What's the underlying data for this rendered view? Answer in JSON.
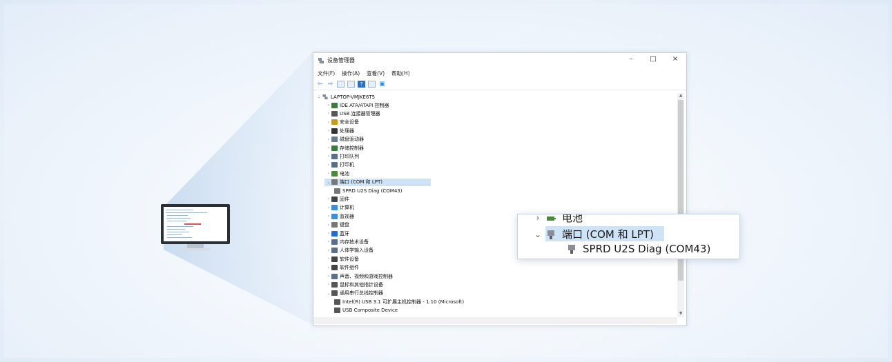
{
  "window": {
    "title": "设备管理器",
    "controls": {
      "minimize": "–",
      "maximize": "□",
      "close": "×"
    }
  },
  "menu": [
    "文件(F)",
    "操作(A)",
    "查看(V)",
    "帮助(H)"
  ],
  "toolbar_icons": [
    "back-arrow-icon",
    "forward-arrow-icon",
    "properties-icon",
    "list-icon",
    "help-icon",
    "view-icon",
    "monitor-icon"
  ],
  "tree": {
    "root": "LAPTOP-VMJKE6T5",
    "items": [
      {
        "label": "IDE ATA/ATAPI 控制器",
        "icon": "ide-controller-icon",
        "color": "#3d7a3d"
      },
      {
        "label": "USB 连接器管理器",
        "icon": "usb-connector-icon",
        "color": "#555555"
      },
      {
        "label": "安全设备",
        "icon": "security-device-icon",
        "color": "#c79a1a"
      },
      {
        "label": "处理器",
        "icon": "processor-icon",
        "color": "#333333"
      },
      {
        "label": "磁盘驱动器",
        "icon": "disk-drive-icon",
        "color": "#6b7b8c"
      },
      {
        "label": "存储控制器",
        "icon": "storage-controller-icon",
        "color": "#3d7a3d"
      },
      {
        "label": "打印队列",
        "icon": "print-queue-icon",
        "color": "#5a6f8a"
      },
      {
        "label": "打印机",
        "icon": "printer-icon",
        "color": "#5a6f8a"
      },
      {
        "label": "电池",
        "icon": "battery-icon",
        "color": "#4c8a3a"
      },
      {
        "label": "端口 (COM 和 LPT)",
        "icon": "port-icon",
        "color": "#777777",
        "expanded": true,
        "selected": true
      },
      {
        "label": "SPRD U2S Diag (COM43)",
        "icon": "port-device-icon",
        "color": "#777777",
        "child": true
      },
      {
        "label": "固件",
        "icon": "firmware-icon",
        "color": "#444444"
      },
      {
        "label": "计算机",
        "icon": "computer-icon",
        "color": "#3b8fd8"
      },
      {
        "label": "监视器",
        "icon": "monitor-device-icon",
        "color": "#3b8fd8"
      },
      {
        "label": "键盘",
        "icon": "keyboard-icon",
        "color": "#777777"
      },
      {
        "label": "蓝牙",
        "icon": "bluetooth-icon",
        "color": "#1f6fd0"
      },
      {
        "label": "内存技术设备",
        "icon": "memory-device-icon",
        "color": "#5a6f8a"
      },
      {
        "label": "人体学输入设备",
        "icon": "hid-icon",
        "color": "#5a6f8a"
      },
      {
        "label": "软件设备",
        "icon": "software-device-icon",
        "color": "#444444"
      },
      {
        "label": "软件组件",
        "icon": "software-component-icon",
        "color": "#444444"
      },
      {
        "label": "声音、视频和游戏控制器",
        "icon": "sound-icon",
        "color": "#5a6f8a"
      },
      {
        "label": "鼠标和其他指针设备",
        "icon": "mouse-icon",
        "color": "#555555"
      },
      {
        "label": "通用串行总线控制器",
        "icon": "usb-controller-icon",
        "color": "#555555",
        "expanded": true
      },
      {
        "label": "Intel(R) USB 3.1 可扩展主机控制器 - 1.10 (Microsoft)",
        "icon": "usb-device-icon",
        "color": "#555555",
        "child": true
      },
      {
        "label": "USB Composite Device",
        "icon": "usb-device-icon",
        "color": "#555555",
        "child": true
      }
    ]
  },
  "zoom": {
    "items": [
      {
        "label": "电池",
        "icon": "battery-icon"
      },
      {
        "label": "端口 (COM 和 LPT)",
        "icon": "port-icon"
      },
      {
        "label": "SPRD U2S Diag (COM43)",
        "icon": "port-device-icon"
      }
    ]
  },
  "colors": {
    "selection": "#cfe3f7",
    "accent": "#3b78c0"
  }
}
